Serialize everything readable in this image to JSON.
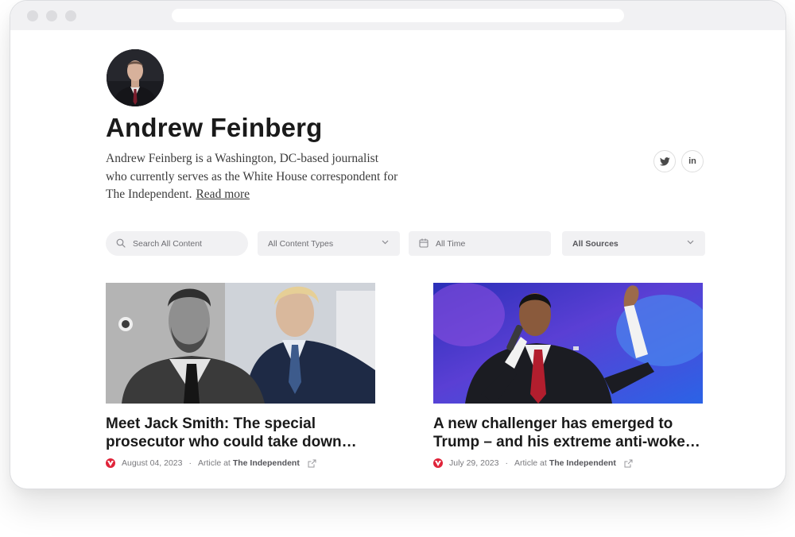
{
  "profile": {
    "name": "Andrew Feinberg",
    "bio": "Andrew Feinberg is a Washington, DC-based journalist who currently serves as the White House correspondent for The Independent.",
    "read_more": "Read more"
  },
  "social": [
    {
      "icon": "twitter-icon"
    },
    {
      "icon": "linkedin-icon",
      "label": "in"
    }
  ],
  "filters": {
    "search_placeholder": "Search All Content",
    "content_types": "All Content Types",
    "time": "All Time",
    "sources": "All Sources"
  },
  "articles": [
    {
      "title": "Meet Jack Smith: The special prosecutor who could take down…",
      "date": "August 04, 2023",
      "type_label": "Article at",
      "source": "The Independent"
    },
    {
      "title": "A new challenger has emerged to Trump – and his extreme anti-woke…",
      "date": "July 29, 2023",
      "type_label": "Article at",
      "source": "The Independent"
    }
  ],
  "colors": {
    "brand_red": "#e0243a",
    "filter_bg": "#f1f1f3",
    "text_dark": "#1a1a1a"
  }
}
